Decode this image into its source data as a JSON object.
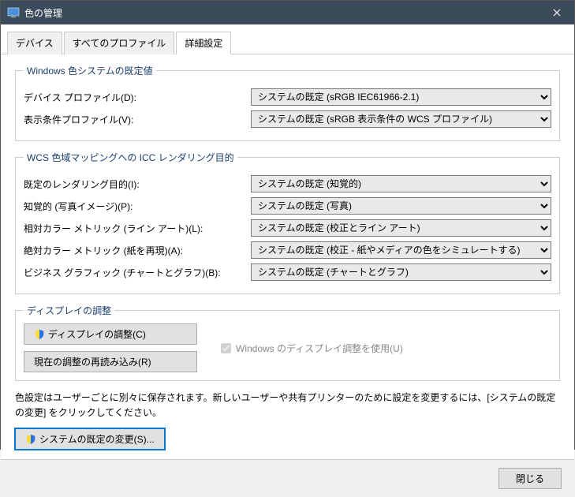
{
  "window": {
    "title": "色の管理"
  },
  "tabs": {
    "t0": "デバイス",
    "t1": "すべてのプロファイル",
    "t2": "詳細設定"
  },
  "group1": {
    "legend": "Windows 色システムの既定値",
    "deviceLabel": "デバイス プロファイル(D):",
    "deviceValue": "システムの既定 (sRGB IEC61966-2.1)",
    "viewLabel": "表示条件プロファイル(V):",
    "viewValue": "システムの既定 (sRGB 表示条件の WCS プロファイル)"
  },
  "group2": {
    "legend": "WCS 色域マッピングへの ICC レンダリング目的",
    "r1l": "既定のレンダリング目的(I):",
    "r1v": "システムの既定 (知覚的)",
    "r2l": "知覚的 (写真イメージ)(P):",
    "r2v": "システムの既定 (写真)",
    "r3l": "相対カラー メトリック (ライン アート)(L):",
    "r3v": "システムの既定 (校正とライン アート)",
    "r4l": "絶対カラー メトリック (紙を再現)(A):",
    "r4v": "システムの既定 (校正 - 紙やメディアの色をシミュレートする)",
    "r5l": "ビジネス グラフィック (チャートとグラフ)(B):",
    "r5v": "システムの既定 (チャートとグラフ)"
  },
  "group3": {
    "legend": "ディスプレイの調整",
    "calibrate": "ディスプレイの調整(C)",
    "reload": "現在の調整の再読み込み(R)",
    "checkbox": "Windows のディスプレイ調整を使用(U)"
  },
  "note": "色設定はユーザーごとに別々に保存されます。新しいユーザーや共有プリンターのために設定を変更するには、[システムの既定の変更] をクリックしてください。",
  "changeDefaults": "システムの既定の変更(S)...",
  "close": "閉じる"
}
